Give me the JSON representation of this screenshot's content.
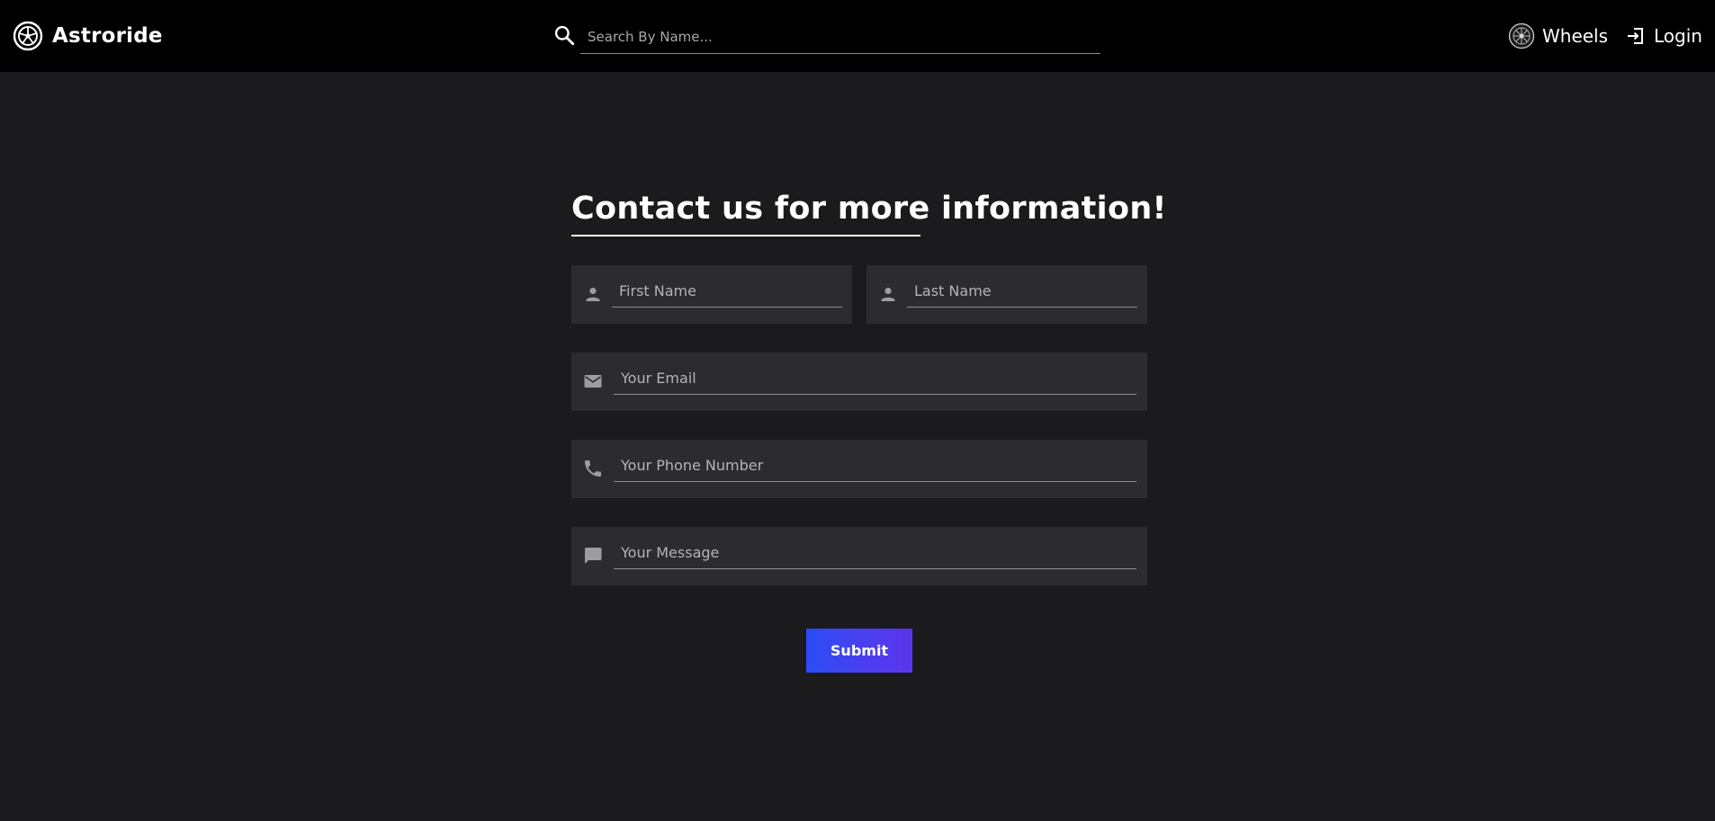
{
  "app": {
    "brand_name": "Astroride"
  },
  "search": {
    "placeholder": "Search By Name..."
  },
  "nav": {
    "wheels_label": "Wheels",
    "login_label": "Login"
  },
  "contact": {
    "title": "Contact us for more information!",
    "first_name_placeholder": "First Name",
    "last_name_placeholder": "Last Name",
    "email_placeholder": "Your Email",
    "phone_placeholder": "Your Phone Number",
    "message_placeholder": "Your Message",
    "submit_label": "Submit"
  },
  "icons": {
    "brand": "wheel-logo-icon",
    "search": "search-icon",
    "wheels": "wheel-icon",
    "login": "login-icon",
    "first_name": "person-icon",
    "last_name": "person-icon",
    "email": "mail-icon",
    "phone": "phone-icon",
    "message": "message-icon"
  },
  "colors": {
    "page_background": "#1b1b1d",
    "topbar_background": "#000000",
    "field_background": "#2c2c2f",
    "button_gradient_start": "#2b4cf5",
    "button_gradient_end": "#5a35ec"
  }
}
